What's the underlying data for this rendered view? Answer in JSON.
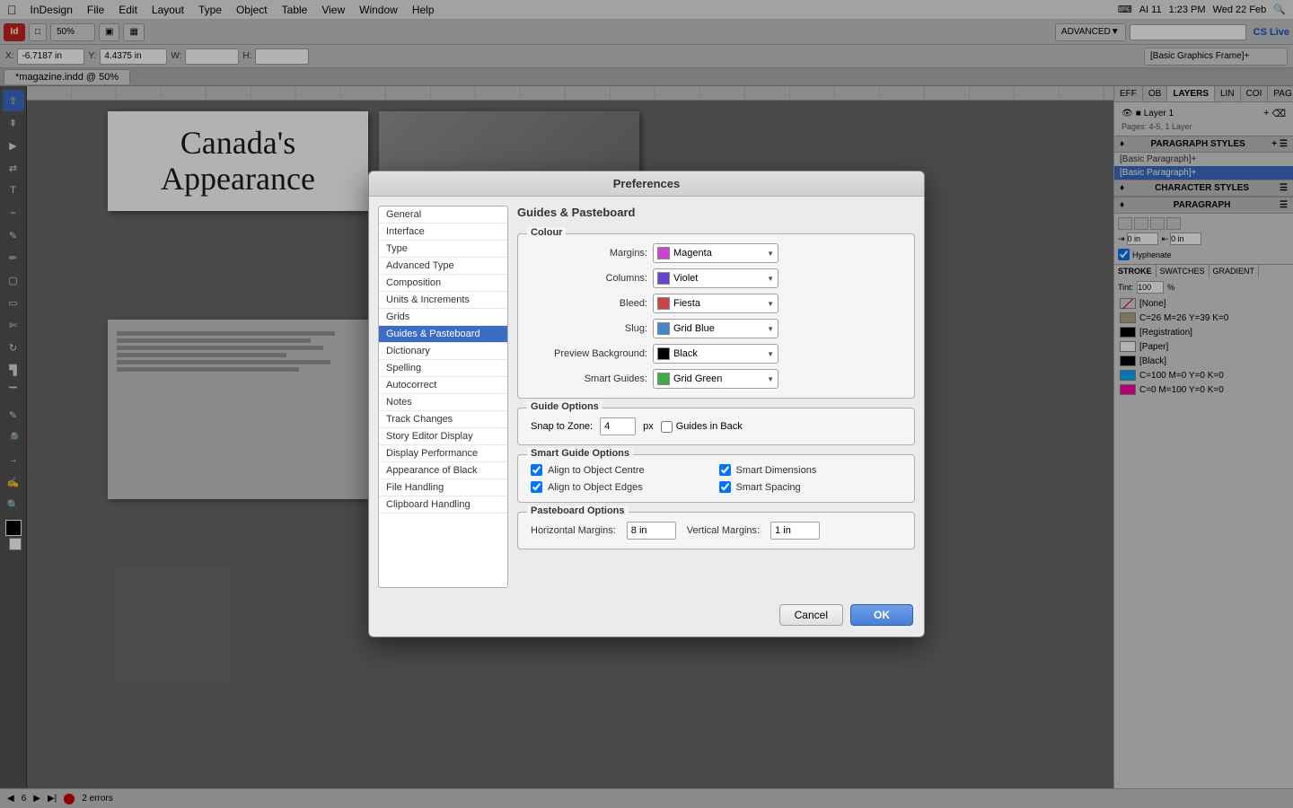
{
  "app": {
    "title": "InDesign",
    "menu_items": [
      "InDesign",
      "File",
      "Edit",
      "Layout",
      "Type",
      "Object",
      "Table",
      "View",
      "Window",
      "Help"
    ],
    "right_menu": [
      "AI 11",
      "1:23 PM",
      "Wed 22 Feb"
    ]
  },
  "toolbar": {
    "zoom": "50%",
    "advanced_label": "ADVANCED",
    "cs_live": "CS Live",
    "file_name": "*magazine.indd @ 50%"
  },
  "coords": {
    "x_label": "X:",
    "x_value": "-6.7187 in",
    "y_label": "Y:",
    "y_value": "4.4375 in",
    "w_label": "W:",
    "h_label": "H:",
    "frame_label": "[Basic Graphics Frame]+"
  },
  "dialog": {
    "title": "Preferences",
    "section_title": "Guides & Pasteboard",
    "sidebar_items": [
      "General",
      "Interface",
      "Type",
      "Advanced Type",
      "Composition",
      "Units & Increments",
      "Grids",
      "Guides & Pasteboard",
      "Dictionary",
      "Spelling",
      "Autocorrect",
      "Notes",
      "Track Changes",
      "Story Editor Display",
      "Display Performance",
      "Appearance of Black",
      "File Handling",
      "Clipboard Handling"
    ],
    "active_item": "Guides & Pasteboard",
    "colour_section": {
      "label": "Colour",
      "margins_label": "Margins:",
      "margins_value": "Magenta",
      "margins_color": "#cc44cc",
      "columns_label": "Columns:",
      "columns_value": "Violet",
      "columns_color": "#6644cc",
      "bleed_label": "Bleed:",
      "bleed_value": "Fiesta",
      "bleed_color": "#cc4444",
      "slug_label": "Slug:",
      "slug_value": "Grid Blue",
      "slug_color": "#4488cc",
      "preview_bg_label": "Preview Background:",
      "preview_bg_value": "Black",
      "preview_bg_color": "#000000",
      "smart_guides_label": "Smart Guides:",
      "smart_guides_value": "Grid Green",
      "smart_guides_color": "#44aa44"
    },
    "guide_options": {
      "label": "Guide Options",
      "snap_to_zone_label": "Snap to Zone:",
      "snap_to_zone_value": "4",
      "snap_to_zone_unit": "px",
      "guides_in_back_label": "Guides in Back",
      "guides_in_back_checked": false
    },
    "smart_guide_options": {
      "label": "Smart Guide Options",
      "align_to_object_centre": "Align to Object Centre",
      "align_to_object_centre_checked": true,
      "align_to_object_edges": "Align to Object Edges",
      "align_to_object_edges_checked": true,
      "smart_dimensions": "Smart Dimensions",
      "smart_dimensions_checked": true,
      "smart_spacing": "Smart Spacing",
      "smart_spacing_checked": true
    },
    "pasteboard_options": {
      "label": "Pasteboard Options",
      "horizontal_margins_label": "Horizontal Margins:",
      "horizontal_margins_value": "8 in",
      "vertical_margins_label": "Vertical Margins:",
      "vertical_margins_value": "1 in"
    },
    "cancel_label": "Cancel",
    "ok_label": "OK"
  },
  "right_panel": {
    "tabs": [
      "EFF",
      "OB",
      "LAYERS",
      "LIN",
      "COI",
      "PAG"
    ],
    "layers_active": "LAYERS",
    "layer_name": "Layer 1",
    "pages_label": "Pages: 4-5, 1 Layer",
    "paragraph_styles_header": "PARAGRAPH STYLES",
    "para_styles": [
      "[Basic Paragraph]+",
      "[Basic Paragraph]+"
    ],
    "character_styles_header": "CHARACTER STYLES",
    "paragraph_header": "PARAGRAPH",
    "stroke_header": "STROKE",
    "swatches_header": "SWATCHES",
    "gradient_header": "GRADIENT",
    "hyphenate_label": "Hyphenate",
    "tint_label": "Tint:",
    "tint_value": "100",
    "swatches": [
      {
        "name": "[None]",
        "color": "transparent",
        "border": "#888"
      },
      {
        "name": "C=26 M=26 Y=39 K=0",
        "color": "#b0a888"
      },
      {
        "name": "[Registration]",
        "color": "#000000"
      },
      {
        "name": "[Paper]",
        "color": "#ffffff"
      },
      {
        "name": "[Black]",
        "color": "#000000"
      },
      {
        "name": "C=100 M=0 Y=0 K=0",
        "color": "#00aaff"
      },
      {
        "name": "C=0 M=100 Y=0 K=0",
        "color": "#ff00aa"
      }
    ]
  },
  "canvas": {
    "title_line1": "Canada's",
    "title_line2": "Appearance"
  },
  "status_bar": {
    "pages": "6",
    "errors": "2 errors"
  }
}
